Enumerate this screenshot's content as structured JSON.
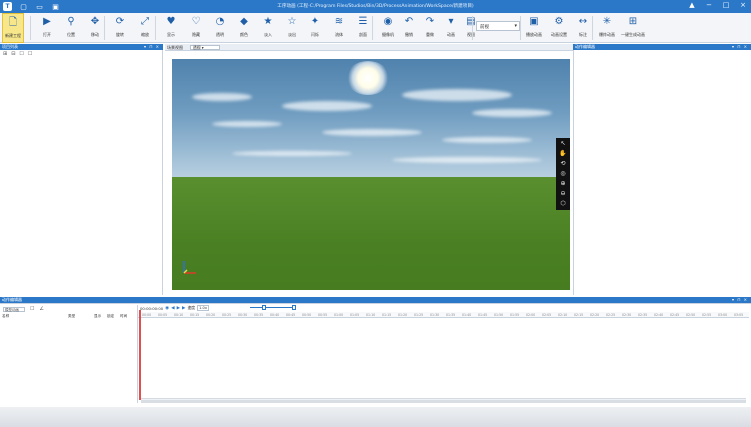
{
  "titlebar": {
    "title": "工序动画 (工程-C:/Program Files/Studios/Bin/3D/ProcessAnimation/WorkSpace/新建项目)",
    "win_minimize": "−",
    "win_maximize": "□",
    "win_close": "×",
    "pin": "▲"
  },
  "ribbon": {
    "items": [
      {
        "label": "新建工程",
        "icon": "new-project-icon",
        "glyph": "🗋"
      },
      {
        "label": "打开",
        "icon": "open-icon",
        "glyph": "▶"
      },
      {
        "label": "位置",
        "icon": "location-icon",
        "glyph": "⚲"
      },
      {
        "label": "移动",
        "icon": "move-icon",
        "glyph": "✥"
      },
      {
        "label": "旋转",
        "icon": "rotate-icon",
        "glyph": "⟳"
      },
      {
        "label": "缩放",
        "icon": "scale-icon",
        "glyph": "⤢"
      },
      {
        "label": "显示",
        "icon": "show-icon",
        "glyph": "♥"
      },
      {
        "label": "隐藏",
        "icon": "hide-icon",
        "glyph": "♡"
      },
      {
        "label": "透明",
        "icon": "transparent-icon",
        "glyph": "◔"
      },
      {
        "label": "颜色",
        "icon": "color-icon",
        "glyph": "◆"
      },
      {
        "label": "淡入",
        "icon": "fade-in-icon",
        "glyph": "★"
      },
      {
        "label": "淡出",
        "icon": "fade-out-icon",
        "glyph": "☆"
      },
      {
        "label": "闪烁",
        "icon": "blink-icon",
        "glyph": "✦"
      },
      {
        "label": "流体",
        "icon": "fluid-icon",
        "glyph": "≋"
      },
      {
        "label": "剖面",
        "icon": "section-icon",
        "glyph": "☰"
      },
      {
        "label": "摄像机",
        "icon": "camera-icon",
        "glyph": "◉"
      },
      {
        "label": "撤销",
        "icon": "undo-icon",
        "glyph": "↶"
      },
      {
        "label": "重做",
        "icon": "redo-icon",
        "glyph": "↷"
      },
      {
        "label": "动画",
        "icon": "animation-icon",
        "glyph": "▾"
      },
      {
        "label": "视图",
        "icon": "view-icon",
        "glyph": "▤"
      },
      {
        "label": "播放动画",
        "icon": "play-animation-icon",
        "glyph": "▣"
      },
      {
        "label": "动画设置",
        "icon": "animation-settings-icon",
        "glyph": "⚙"
      },
      {
        "label": "标注",
        "icon": "annotation-icon",
        "glyph": "↔"
      },
      {
        "label": "爆炸动画",
        "icon": "explode-icon",
        "glyph": "✳"
      },
      {
        "label": "一键生成动画",
        "icon": "auto-generate-icon",
        "glyph": "⊞"
      }
    ],
    "view_combo": "前视"
  },
  "left_panel": {
    "header": "项目列表",
    "controls": "▾ ⊓ ×",
    "tools": [
      "⊞",
      "⊟",
      "☐",
      "☐"
    ]
  },
  "viewport": {
    "tab": "场景视图",
    "combo": "透视 ▾"
  },
  "viewport_tools": [
    "↖",
    "✋",
    "⟲",
    "◎",
    "⊕",
    "⊖",
    "⬡"
  ],
  "right_panel": {
    "header": "动作编辑器",
    "controls": "▾ ⊓ ×"
  },
  "timeline": {
    "header": "动作编辑器",
    "controls": "▾ ⊓ ×",
    "combo": "模型动画",
    "tool_glyphs": [
      "☐",
      "∠"
    ],
    "columns": {
      "name": "名称",
      "type": "类型",
      "visible": "显示",
      "lock": "锁定",
      "time": "时间"
    },
    "time": "00:00:00:00",
    "speed_label": "速度",
    "speed_value": "1.0x",
    "transport": [
      "◉",
      "◀",
      "▶",
      "▶"
    ],
    "ticks": [
      "00:00",
      "00:05",
      "00:10",
      "00:15",
      "00:20",
      "00:25",
      "00:30",
      "00:35",
      "00:40",
      "00:45",
      "00:50",
      "00:55",
      "01:00",
      "01:05",
      "01:10",
      "01:15",
      "01:20",
      "01:25",
      "01:30",
      "01:35",
      "01:40",
      "01:45",
      "01:50",
      "01:55",
      "02:00",
      "02:05",
      "02:10",
      "02:15",
      "02:20",
      "02:25",
      "02:30",
      "02:35",
      "02:40",
      "02:45",
      "02:50",
      "02:55",
      "03:00",
      "03:05"
    ]
  }
}
